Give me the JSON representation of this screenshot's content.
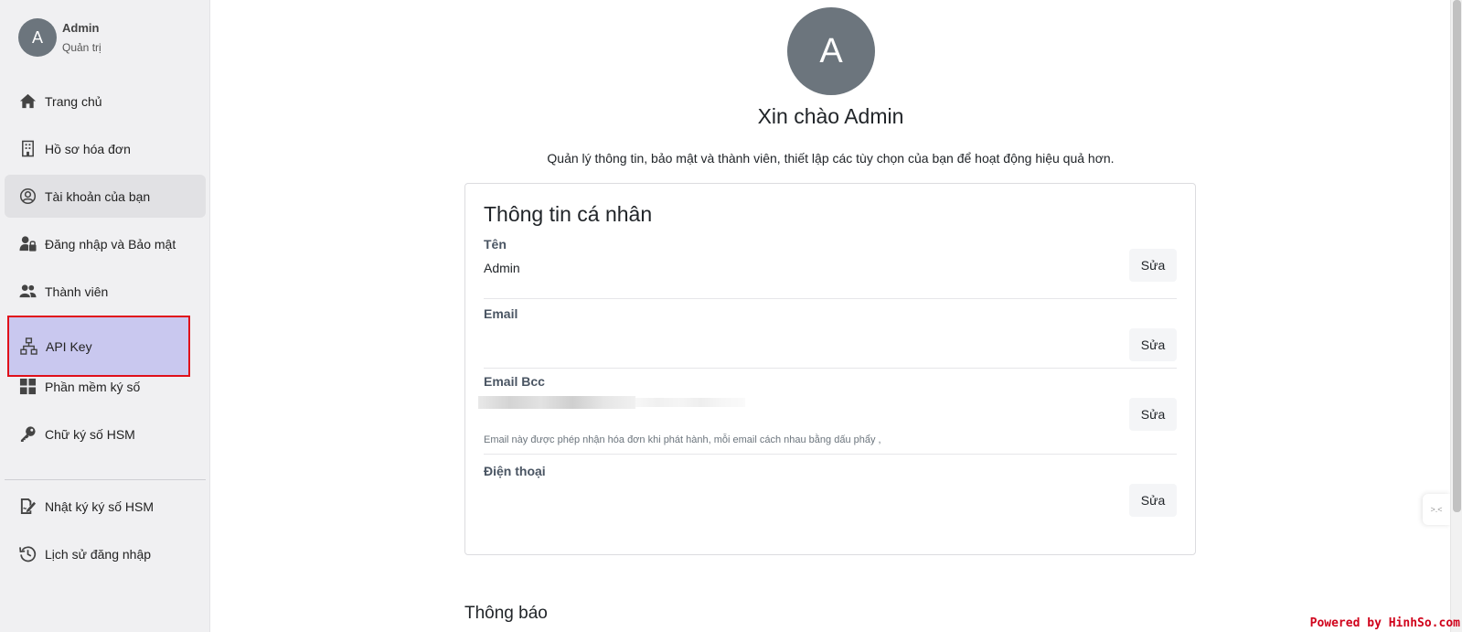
{
  "user": {
    "avatar_letter": "A",
    "name": "Admin",
    "role": "Quản trị"
  },
  "sidebar": {
    "items": [
      {
        "label": "Trang chủ",
        "icon": "home-icon"
      },
      {
        "label": "Hồ sơ hóa đơn",
        "icon": "building-icon"
      },
      {
        "label": "Tài khoản của bạn",
        "icon": "user-circle-icon"
      },
      {
        "label": "Đăng nhập và Bảo mật",
        "icon": "user-lock-icon"
      },
      {
        "label": "Thành viên",
        "icon": "users-icon"
      },
      {
        "label": "API Key",
        "icon": "network-icon"
      },
      {
        "label": "Phần mềm ký số",
        "icon": "grid-icon"
      },
      {
        "label": "Chữ ký số HSM",
        "icon": "key-icon"
      },
      {
        "label": "Nhật ký ký số HSM",
        "icon": "signature-icon"
      },
      {
        "label": "Lịch sử đăng nhập",
        "icon": "history-icon"
      }
    ],
    "active_item": "Tài khoản của bạn",
    "highlighted_item": "API Key"
  },
  "main": {
    "avatar_letter": "A",
    "greeting": "Xin chào Admin",
    "subtitle": "Quản lý thông tin, bảo mật và thành viên, thiết lập các tùy chọn của bạn để hoạt động hiệu quả hơn.",
    "card": {
      "title": "Thông tin cá nhân",
      "edit_label": "Sửa",
      "fields": {
        "name": {
          "label": "Tên",
          "value": "Admin"
        },
        "email": {
          "label": "Email",
          "value": ""
        },
        "email_bcc": {
          "label": "Email Bcc",
          "hint": "Email này được phép nhận hóa đơn khi phát hành, mỗi email cách nhau bằng dấu phẩy ,"
        },
        "phone": {
          "label": "Điện thoại",
          "value": ""
        }
      }
    },
    "notifications_title": "Thông báo"
  },
  "float_handle_text": ">.<",
  "watermark": "Powered by HinhSo.com",
  "colors": {
    "highlight_bg": "#c9c8ef",
    "highlight_border": "#e0101a",
    "avatar": "#6c757d"
  }
}
